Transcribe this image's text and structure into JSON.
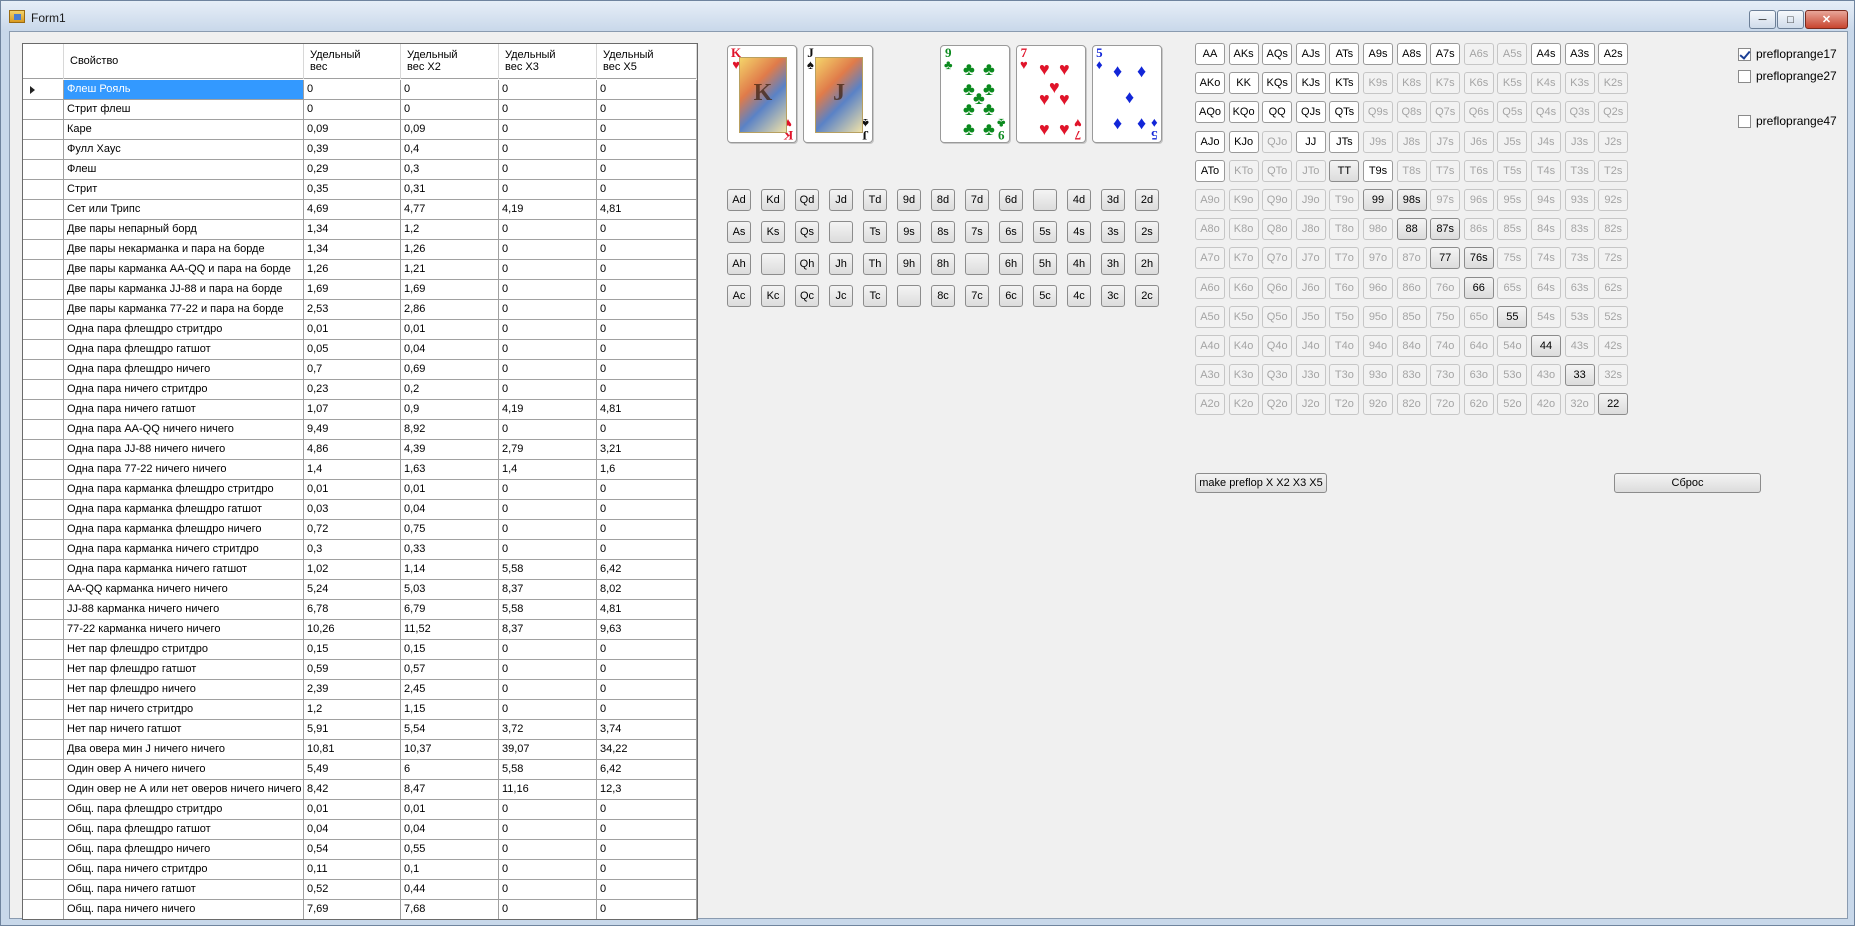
{
  "window": {
    "title": "Form1",
    "minimize": "─",
    "maximize": "□",
    "close": "✕"
  },
  "grid": {
    "headers": {
      "property": "Свойство",
      "w1": "Удельный\nвес",
      "w2": "Удельный\nвес X2",
      "w3": "Удельный\nвес X3",
      "w5": "Удельный\nвес X5"
    },
    "rows": [
      [
        "Флеш Рояль",
        "0",
        "0",
        "0",
        "0"
      ],
      [
        "Стрит флеш",
        "0",
        "0",
        "0",
        "0"
      ],
      [
        "Каре",
        "0,09",
        "0,09",
        "0",
        "0"
      ],
      [
        "Фулл Хаус",
        "0,39",
        "0,4",
        "0",
        "0"
      ],
      [
        "Флеш",
        "0,29",
        "0,3",
        "0",
        "0"
      ],
      [
        "Стрит",
        "0,35",
        "0,31",
        "0",
        "0"
      ],
      [
        "Сет или Трипс",
        "4,69",
        "4,77",
        "4,19",
        "4,81"
      ],
      [
        "Две пары непарный борд",
        "1,34",
        "1,2",
        "0",
        "0"
      ],
      [
        "Две пары некарманка и пара на борде",
        "1,34",
        "1,26",
        "0",
        "0"
      ],
      [
        "Две пары карманка АА-QQ и пара на борде",
        "1,26",
        "1,21",
        "0",
        "0"
      ],
      [
        "Две пары карманка JJ-88 и пара на борде",
        "1,69",
        "1,69",
        "0",
        "0"
      ],
      [
        "Две пары карманка 77-22 и пара на борде",
        "2,53",
        "2,86",
        "0",
        "0"
      ],
      [
        "Одна пара флешдро стритдро",
        "0,01",
        "0,01",
        "0",
        "0"
      ],
      [
        "Одна пара флешдро гатшот",
        "0,05",
        "0,04",
        "0",
        "0"
      ],
      [
        "Одна пара флешдро ничего",
        "0,7",
        "0,69",
        "0",
        "0"
      ],
      [
        "Одна пара ничего стритдро",
        "0,23",
        "0,2",
        "0",
        "0"
      ],
      [
        "Одна пара ничего гатшот",
        "1,07",
        "0,9",
        "4,19",
        "4,81"
      ],
      [
        "Одна пара АА-QQ ничего ничего",
        "9,49",
        "8,92",
        "0",
        "0"
      ],
      [
        "Одна пара JJ-88 ничего ничего",
        "4,86",
        "4,39",
        "2,79",
        "3,21"
      ],
      [
        "Одна пара 77-22 ничего ничего",
        "1,4",
        "1,63",
        "1,4",
        "1,6"
      ],
      [
        "Одна пара карманка флешдро стритдро",
        "0,01",
        "0,01",
        "0",
        "0"
      ],
      [
        "Одна пара карманка флешдро гатшот",
        "0,03",
        "0,04",
        "0",
        "0"
      ],
      [
        "Одна пара карманка флешдро ничего",
        "0,72",
        "0,75",
        "0",
        "0"
      ],
      [
        "Одна пара карманка ничего стритдро",
        "0,3",
        "0,33",
        "0",
        "0"
      ],
      [
        "Одна пара карманка ничего гатшот",
        "1,02",
        "1,14",
        "5,58",
        "6,42"
      ],
      [
        "АА-QQ карманка ничего ничего",
        "5,24",
        "5,03",
        "8,37",
        "8,02"
      ],
      [
        "JJ-88 карманка ничего ничего",
        "6,78",
        "6,79",
        "5,58",
        "4,81"
      ],
      [
        "77-22 карманка ничего ничего",
        "10,26",
        "11,52",
        "8,37",
        "9,63"
      ],
      [
        "Нет пар флешдро стритдро",
        "0,15",
        "0,15",
        "0",
        "0"
      ],
      [
        "Нет пар флешдро гатшот",
        "0,59",
        "0,57",
        "0",
        "0"
      ],
      [
        "Нет пар флешдро ничего",
        "2,39",
        "2,45",
        "0",
        "0"
      ],
      [
        "Нет пар ничего стритдро",
        "1,2",
        "1,15",
        "0",
        "0"
      ],
      [
        "Нет пар ничего гатшот",
        "5,91",
        "5,54",
        "3,72",
        "3,74"
      ],
      [
        "Два овера мин J ничего ничего",
        "10,81",
        "10,37",
        "39,07",
        "34,22"
      ],
      [
        "Один овер А ничего ничего",
        "5,49",
        "6",
        "5,58",
        "6,42"
      ],
      [
        "Один овер не А или нет оверов ничего ничего",
        "8,42",
        "8,47",
        "11,16",
        "12,3"
      ],
      [
        "Общ. пара флешдро стритдро",
        "0,01",
        "0,01",
        "0",
        "0"
      ],
      [
        "Общ. пара флешдро гатшот",
        "0,04",
        "0,04",
        "0",
        "0"
      ],
      [
        "Общ. пара флешдро ничего",
        "0,54",
        "0,55",
        "0",
        "0"
      ],
      [
        "Общ. пара ничего стритдро",
        "0,11",
        "0,1",
        "0",
        "0"
      ],
      [
        "Общ. пара ничего гатшот",
        "0,52",
        "0,44",
        "0",
        "0"
      ],
      [
        "Общ. пара ничего ничего",
        "7,69",
        "7,68",
        "0",
        "0"
      ]
    ]
  },
  "cards": [
    {
      "rank": "K",
      "suit": "♥",
      "color": "#e0142a",
      "face": true
    },
    {
      "rank": "J",
      "suit": "♠",
      "color": "#111111",
      "face": true
    },
    {
      "rank": "9",
      "suit": "♣",
      "color": "#0b8a1e",
      "face": false
    },
    {
      "rank": "7",
      "suit": "♥",
      "color": "#e0142a",
      "face": false
    },
    {
      "rank": "5",
      "suit": "♦",
      "color": "#1226d8",
      "face": false
    }
  ],
  "card_buttons": [
    [
      "Ad",
      "Kd",
      "Qd",
      "Jd",
      "Td",
      "9d",
      "8d",
      "7d",
      "6d",
      "",
      "4d",
      "3d",
      "2d"
    ],
    [
      "As",
      "Ks",
      "Qs",
      "",
      "Ts",
      "9s",
      "8s",
      "7s",
      "6s",
      "5s",
      "4s",
      "3s",
      "2s"
    ],
    [
      "Ah",
      "",
      "Qh",
      "Jh",
      "Th",
      "9h",
      "8h",
      "",
      "6h",
      "5h",
      "4h",
      "3h",
      "2h"
    ],
    [
      "Ac",
      "Kc",
      "Qc",
      "Jc",
      "Tc",
      "",
      "8c",
      "7c",
      "6c",
      "5c",
      "4c",
      "3c",
      "2c"
    ]
  ],
  "range_grid": [
    [
      "AA",
      "AKs",
      "AQs",
      "AJs",
      "ATs",
      "A9s",
      "A8s",
      "A7s",
      "A6s",
      "A5s",
      "A4s",
      "A3s",
      "A2s"
    ],
    [
      "AKo",
      "KK",
      "KQs",
      "KJs",
      "KTs",
      "K9s",
      "K8s",
      "K7s",
      "K6s",
      "K5s",
      "K4s",
      "K3s",
      "K2s"
    ],
    [
      "AQo",
      "KQo",
      "QQ",
      "QJs",
      "QTs",
      "Q9s",
      "Q8s",
      "Q7s",
      "Q6s",
      "Q5s",
      "Q4s",
      "Q3s",
      "Q2s"
    ],
    [
      "AJo",
      "KJo",
      "QJo",
      "JJ",
      "JTs",
      "J9s",
      "J8s",
      "J7s",
      "J6s",
      "J5s",
      "J4s",
      "J3s",
      "J2s"
    ],
    [
      "ATo",
      "KTo",
      "QTo",
      "JTo",
      "TT",
      "T9s",
      "T8s",
      "T7s",
      "T6s",
      "T5s",
      "T4s",
      "T3s",
      "T2s"
    ],
    [
      "A9o",
      "K9o",
      "Q9o",
      "J9o",
      "T9o",
      "99",
      "98s",
      "97s",
      "96s",
      "95s",
      "94s",
      "93s",
      "92s"
    ],
    [
      "A8o",
      "K8o",
      "Q8o",
      "J8o",
      "T8o",
      "98o",
      "88",
      "87s",
      "86s",
      "85s",
      "84s",
      "83s",
      "82s"
    ],
    [
      "A7o",
      "K7o",
      "Q7o",
      "J7o",
      "T7o",
      "97o",
      "87o",
      "77",
      "76s",
      "75s",
      "74s",
      "73s",
      "72s"
    ],
    [
      "A6o",
      "K6o",
      "Q6o",
      "J6o",
      "T6o",
      "96o",
      "86o",
      "76o",
      "66",
      "65s",
      "64s",
      "63s",
      "62s"
    ],
    [
      "A5o",
      "K5o",
      "Q5o",
      "J5o",
      "T5o",
      "95o",
      "85o",
      "75o",
      "65o",
      "55",
      "54s",
      "53s",
      "52s"
    ],
    [
      "A4o",
      "K4o",
      "Q4o",
      "J4o",
      "T4o",
      "94o",
      "84o",
      "74o",
      "64o",
      "54o",
      "44",
      "43s",
      "42s"
    ],
    [
      "A3o",
      "K3o",
      "Q3o",
      "J3o",
      "T3o",
      "93o",
      "83o",
      "73o",
      "63o",
      "53o",
      "43o",
      "33",
      "32s"
    ],
    [
      "A2o",
      "K2o",
      "Q2o",
      "J2o",
      "T2o",
      "92o",
      "82o",
      "72o",
      "62o",
      "52o",
      "42o",
      "32o",
      "22"
    ]
  ],
  "range_enabled": [
    "AA",
    "AKs",
    "AQs",
    "AJs",
    "ATs",
    "A9s",
    "A8s",
    "A7s",
    "A4s",
    "A3s",
    "A2s",
    "AKo",
    "KK",
    "KQs",
    "KJs",
    "KTs",
    "AQo",
    "KQo",
    "QQ",
    "QJs",
    "QTs",
    "AJo",
    "KJo",
    "JJ",
    "JTs",
    "ATo",
    "TT",
    "T9s",
    "99",
    "98s",
    "88",
    "87s",
    "77",
    "76s",
    "66",
    "55",
    "44",
    "33",
    "22"
  ],
  "range_white": [
    "AA",
    "AKs",
    "AQs",
    "AJs",
    "ATs",
    "A9s",
    "A8s",
    "A7s",
    "A4s",
    "A3s",
    "A2s",
    "AKo",
    "KK",
    "KQs",
    "KJs",
    "KTs",
    "AQo",
    "KQo",
    "QQ",
    "QJs",
    "QTs",
    "AJo",
    "KJo",
    "JJ",
    "JTs",
    "ATo",
    "T9s"
  ],
  "checkboxes": [
    {
      "label": "preflop​range17",
      "checked": true
    },
    {
      "label": "preflop​range27",
      "checked": false
    },
    {
      "label": "preflop​range47",
      "checked": false
    }
  ],
  "buttons": {
    "make": "make preflop X X2 X3 X5",
    "reset": "Сброс"
  }
}
